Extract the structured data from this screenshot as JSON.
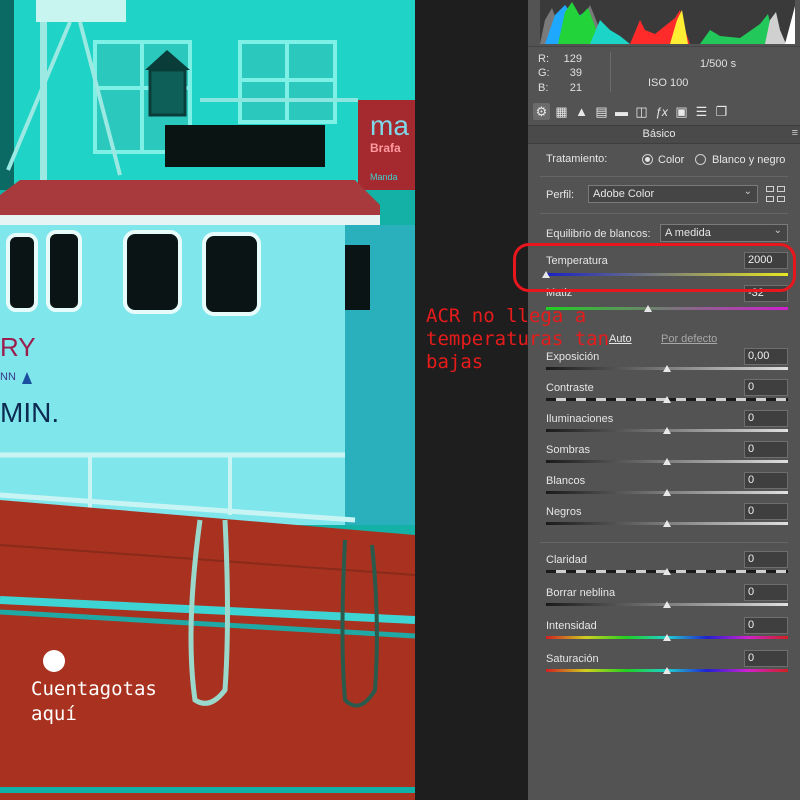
{
  "photo": {
    "sign_text": "ma",
    "sign_sub": "Brafa",
    "sign_small": "Manda",
    "hull_text_1": "RY",
    "hull_text_2": "NN",
    "hull_text_3": "MIN."
  },
  "readout": {
    "r_label": "R:",
    "r_value": "129",
    "g_label": "G:",
    "g_value": "39",
    "b_label": "B:",
    "b_value": "21",
    "shutter": "1/500 s",
    "iso": "ISO 100"
  },
  "tabs": [
    {
      "icon": "aperture-icon",
      "glyph": "⚙"
    },
    {
      "icon": "tone-curve-grid-icon",
      "glyph": "▦"
    },
    {
      "icon": "mountain-detail-icon",
      "glyph": "▲"
    },
    {
      "icon": "hsl-icon",
      "glyph": "▤"
    },
    {
      "icon": "split-tone-icon",
      "glyph": "▬"
    },
    {
      "icon": "lens-icon",
      "glyph": "◫"
    },
    {
      "icon": "fx-icon",
      "glyph": "ƒx"
    },
    {
      "icon": "camera-calibration-icon",
      "glyph": "▣"
    },
    {
      "icon": "sliders-icon",
      "glyph": "☰"
    },
    {
      "icon": "presets-icon",
      "glyph": "❐"
    }
  ],
  "section_title": "Básico",
  "treatment": {
    "label": "Tratamiento:",
    "color_label": "Color",
    "bw_label": "Blanco y negro"
  },
  "profile": {
    "label": "Perfil:",
    "value": "Adobe Color"
  },
  "white_balance": {
    "label": "Equilibrio de blancos:",
    "value": "A medida"
  },
  "temperature": {
    "label": "Temperatura",
    "value": "2000",
    "level": 0.0
  },
  "tint": {
    "label": "Matiz",
    "value": "-32",
    "level": 0.42
  },
  "auto_label": "Auto",
  "default_label": "Por defecto",
  "tone_sliders": [
    {
      "key": "exposure",
      "label": "Exposición",
      "value": "0,00"
    },
    {
      "key": "contrast",
      "label": "Contraste",
      "value": "0"
    },
    {
      "key": "highlights",
      "label": "Iluminaciones",
      "value": "0"
    },
    {
      "key": "shadows",
      "label": "Sombras",
      "value": "0"
    },
    {
      "key": "whites",
      "label": "Blancos",
      "value": "0"
    },
    {
      "key": "blacks",
      "label": "Negros",
      "value": "0"
    }
  ],
  "presence_sliders": [
    {
      "key": "clarity",
      "label": "Claridad",
      "value": "0"
    },
    {
      "key": "dehaze",
      "label": "Borrar neblina",
      "value": "0"
    },
    {
      "key": "vibrance",
      "label": "Intensidad",
      "value": "0"
    },
    {
      "key": "saturation",
      "label": "Saturación",
      "value": "0"
    }
  ],
  "annotation_note": "ACR no llega a\ntemperaturas tan\nbajas",
  "eyedropper_note": "Cuentagotas\naquí",
  "colors": {
    "annotation_red": "#e8161d",
    "panel_bg": "#535353",
    "photo_cyan": "#1fd6c8",
    "hull_red": "#a8321f"
  }
}
